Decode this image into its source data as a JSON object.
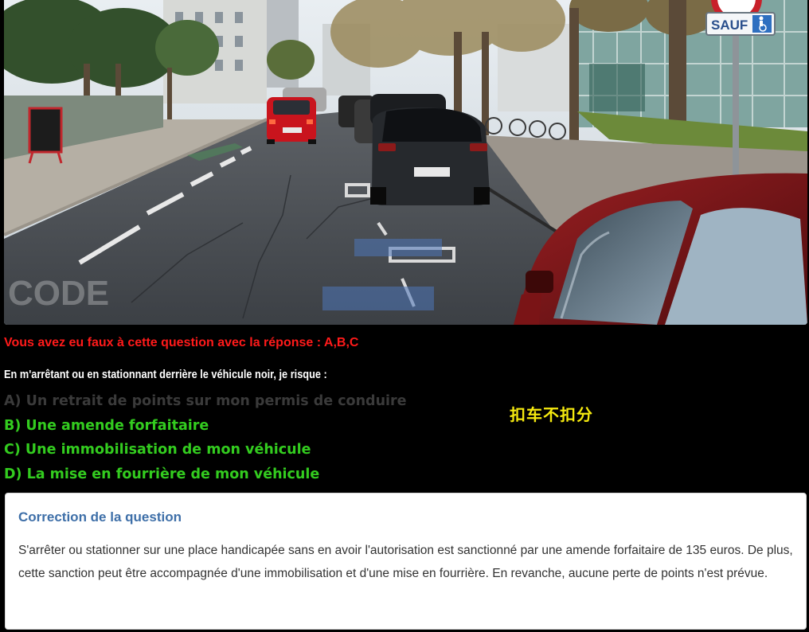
{
  "photo": {
    "sign_text": "SAUF",
    "watermark": "CODE"
  },
  "result": {
    "text": "Vous avez eu faux à cette question avec la réponse : A,B,C",
    "color": "#ff1a1a"
  },
  "question": {
    "text": "En m'arrêtant ou en stationnant derrière le véhicule noir, je risque :"
  },
  "answers": [
    {
      "label": "A) Un retrait de points sur mon permis de conduire",
      "status": "wrong",
      "color": "#3a3a3a"
    },
    {
      "label": "B) Une amende forfaitaire",
      "status": "correct",
      "color": "#33cc1f"
    },
    {
      "label": "C) Une immobilisation de mon véhicule",
      "status": "correct",
      "color": "#33cc1f"
    },
    {
      "label": "D) La mise en fourrière de mon véhicule",
      "status": "correct",
      "color": "#33cc1f"
    }
  ],
  "note": {
    "text": "扣车不扣分",
    "color": "#f5e90f"
  },
  "correction": {
    "title": "Correction de la question",
    "body": "S'arrêter ou stationner sur une place handicapée sans en avoir l'autorisation est sanctionné par une amende forfaitaire de 135 euros. De plus, cette sanction peut être accompagnée d'une immobilisation et d'une mise en fourrière. En revanche, aucune perte de points n'est prévue."
  }
}
